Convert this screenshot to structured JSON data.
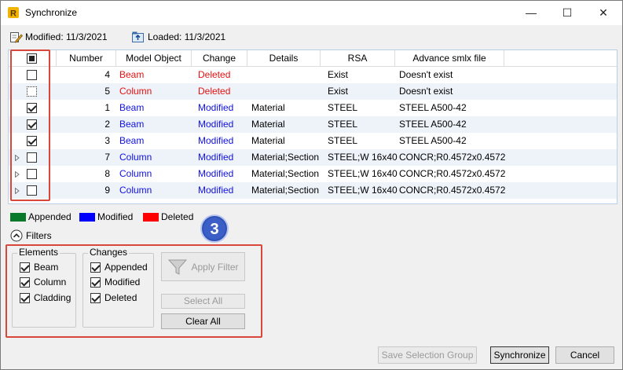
{
  "window": {
    "title": "Synchronize",
    "minimize": "—",
    "maximize": "☐",
    "close": "✕"
  },
  "info": {
    "modified": "Modified: 11/3/2021",
    "loaded": "Loaded: 11/3/2021"
  },
  "colors": {
    "appended": "#0a7a2a",
    "modified": "#0000ff",
    "deleted": "#ff0000",
    "highlight": "#d9473a"
  },
  "grid": {
    "columns": [
      "Number",
      "Model Object",
      "Change",
      "Details",
      "RSA",
      "Advance smlx file"
    ],
    "rows": [
      {
        "number": "4",
        "object": "Beam",
        "change": "Deleted",
        "details": "",
        "rsa": "Exist",
        "smlx": "Doesn't exist",
        "color": "red",
        "checked": false,
        "expandable": false
      },
      {
        "number": "5",
        "object": "Column",
        "change": "Deleted",
        "details": "",
        "rsa": "Exist",
        "smlx": "Doesn't exist",
        "color": "red",
        "checked": false,
        "expandable": false,
        "focused": true
      },
      {
        "number": "1",
        "object": "Beam",
        "change": "Modified",
        "details": "Material",
        "rsa": "STEEL",
        "smlx": "STEEL A500-42",
        "color": "blue",
        "checked": true,
        "expandable": false
      },
      {
        "number": "2",
        "object": "Beam",
        "change": "Modified",
        "details": "Material",
        "rsa": "STEEL",
        "smlx": "STEEL A500-42",
        "color": "blue",
        "checked": true,
        "expandable": false
      },
      {
        "number": "3",
        "object": "Beam",
        "change": "Modified",
        "details": "Material",
        "rsa": "STEEL",
        "smlx": "STEEL A500-42",
        "color": "blue",
        "checked": true,
        "expandable": false
      },
      {
        "number": "7",
        "object": "Column",
        "change": "Modified",
        "details": "Material;Section",
        "rsa": "STEEL;W 16x40",
        "smlx": "CONCR;R0.4572x0.4572",
        "color": "blue",
        "checked": false,
        "expandable": true
      },
      {
        "number": "8",
        "object": "Column",
        "change": "Modified",
        "details": "Material;Section",
        "rsa": "STEEL;W 16x40",
        "smlx": "CONCR;R0.4572x0.4572",
        "color": "blue",
        "checked": false,
        "expandable": true
      },
      {
        "number": "9",
        "object": "Column",
        "change": "Modified",
        "details": "Material;Section",
        "rsa": "STEEL;W 16x40",
        "smlx": "CONCR;R0.4572x0.4572",
        "color": "blue",
        "checked": false,
        "expandable": true
      }
    ]
  },
  "legend": {
    "appended": "Appended",
    "modified": "Modified",
    "deleted": "Deleted"
  },
  "filters": {
    "toggle_label": "Filters",
    "badge": "3",
    "elements": {
      "title": "Elements",
      "items": [
        {
          "label": "Beam",
          "checked": true
        },
        {
          "label": "Column",
          "checked": true
        },
        {
          "label": "Cladding",
          "checked": true
        }
      ]
    },
    "changes": {
      "title": "Changes",
      "items": [
        {
          "label": "Appended",
          "checked": true
        },
        {
          "label": "Modified",
          "checked": true
        },
        {
          "label": "Deleted",
          "checked": true
        }
      ]
    },
    "apply_filter": "Apply Filter",
    "select_all": "Select All",
    "clear_all": "Clear All"
  },
  "footer": {
    "save_group": "Save Selection Group",
    "synchronize": "Synchronize",
    "cancel": "Cancel"
  }
}
